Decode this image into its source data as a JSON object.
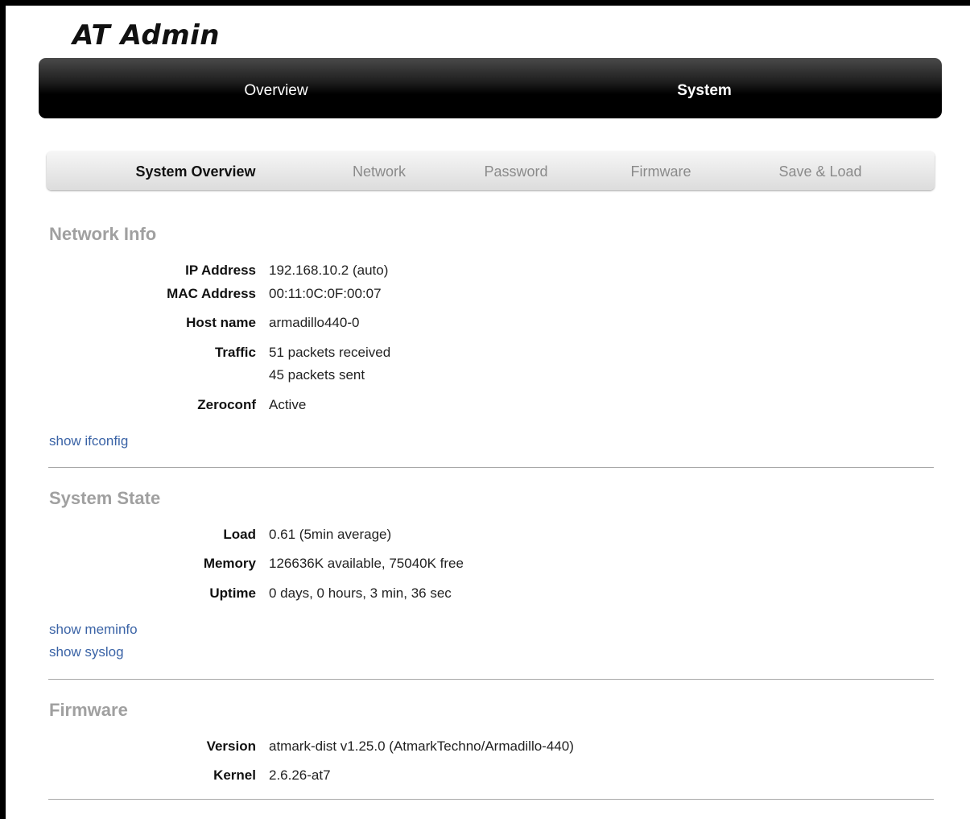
{
  "app": {
    "logo": "AT Admin"
  },
  "main_nav": {
    "tabs": [
      {
        "label": "Overview",
        "active": false
      },
      {
        "label": "System",
        "active": true
      }
    ]
  },
  "sub_nav": {
    "tabs": [
      {
        "label": "System Overview",
        "active": true
      },
      {
        "label": "Network",
        "active": false
      },
      {
        "label": "Password",
        "active": false
      },
      {
        "label": "Firmware",
        "active": false
      },
      {
        "label": "Save & Load",
        "active": false
      }
    ]
  },
  "network_info": {
    "title": "Network Info",
    "ip_label": "IP Address",
    "ip_value": "192.168.10.2 (auto)",
    "mac_label": "MAC Address",
    "mac_value": "00:11:0C:0F:00:07",
    "host_label": "Host name",
    "host_value": "armadillo440-0",
    "traffic_label": "Traffic",
    "traffic_received": "51 packets received",
    "traffic_sent": "45 packets sent",
    "zeroconf_label": "Zeroconf",
    "zeroconf_value": "Active",
    "link_ifconfig": "show ifconfig"
  },
  "system_state": {
    "title": "System State",
    "load_label": "Load",
    "load_value": "0.61 (5min average)",
    "memory_label": "Memory",
    "memory_value": "126636K available, 75040K free",
    "uptime_label": "Uptime",
    "uptime_value": "0 days, 0 hours, 3 min, 36 sec",
    "link_meminfo": "show meminfo",
    "link_syslog": "show syslog"
  },
  "firmware": {
    "title": "Firmware",
    "version_label": "Version",
    "version_value": "atmark-dist v1.25.0 (AtmarkTechno/Armadillo-440)",
    "kernel_label": "Kernel",
    "kernel_value": "2.6.26-at7"
  },
  "colors": {
    "nav_bg": "#000000",
    "subnav_bg": "#dcdcdc",
    "section_title": "#a0a0a0",
    "link": "#3a63a6"
  }
}
